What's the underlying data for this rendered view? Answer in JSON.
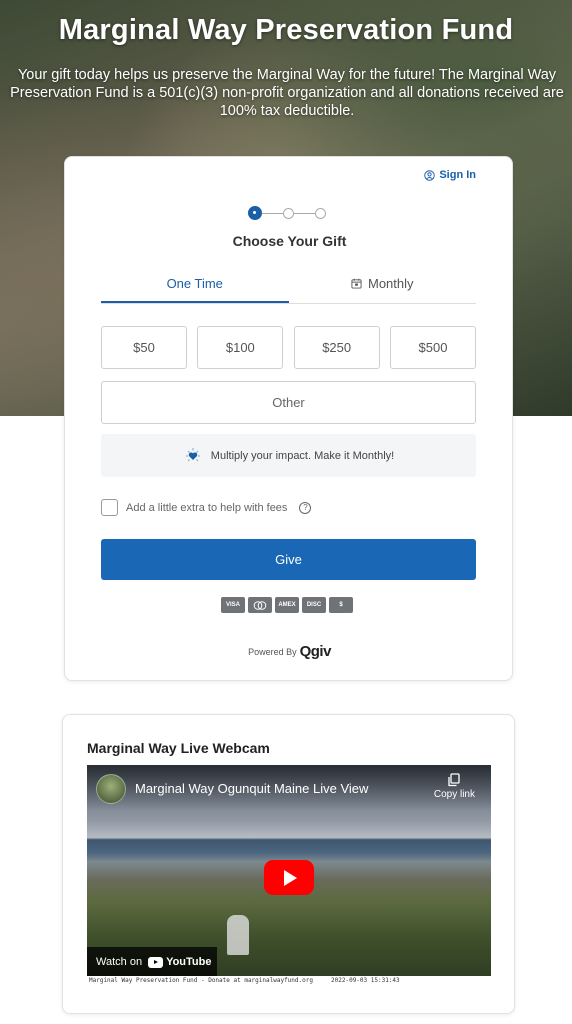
{
  "hero": {
    "title": "Marginal Way Preservation Fund",
    "subtitle": "Your gift today helps us preserve the Marginal Way for the future! The Marginal Way Preservation Fund is a 501(c)(3) non-profit organization and all donations received are 100% tax deductible."
  },
  "form": {
    "sign_in": "Sign In",
    "step_title": "Choose Your Gift",
    "tabs": [
      {
        "label": "One Time",
        "active": true
      },
      {
        "label": "Monthly",
        "active": false
      }
    ],
    "amounts": [
      "$50",
      "$100",
      "$250",
      "$500"
    ],
    "other": "Other",
    "promo": "Multiply your impact. Make it Monthly!",
    "fees_label": "Add a little extra to help with fees",
    "give": "Give",
    "payment_methods": [
      "VISA",
      "MC",
      "AMEX",
      "DISC",
      "$"
    ],
    "powered_by": "Powered By",
    "brand": "Qgiv"
  },
  "webcam": {
    "title": "Marginal Way Live Webcam",
    "video_title": "Marginal Way Ogunquit Maine Live View",
    "copy_link": "Copy link",
    "watch_on": "Watch on",
    "youtube": "YouTube",
    "ticker": "Marginal Way Preservation Fund - Donate at marginalwayfund.org     2022-09-03 15:31:43"
  },
  "colors": {
    "accent": "#1a5fa8",
    "give_button": "#1a67b5",
    "play": "#ff0000"
  }
}
